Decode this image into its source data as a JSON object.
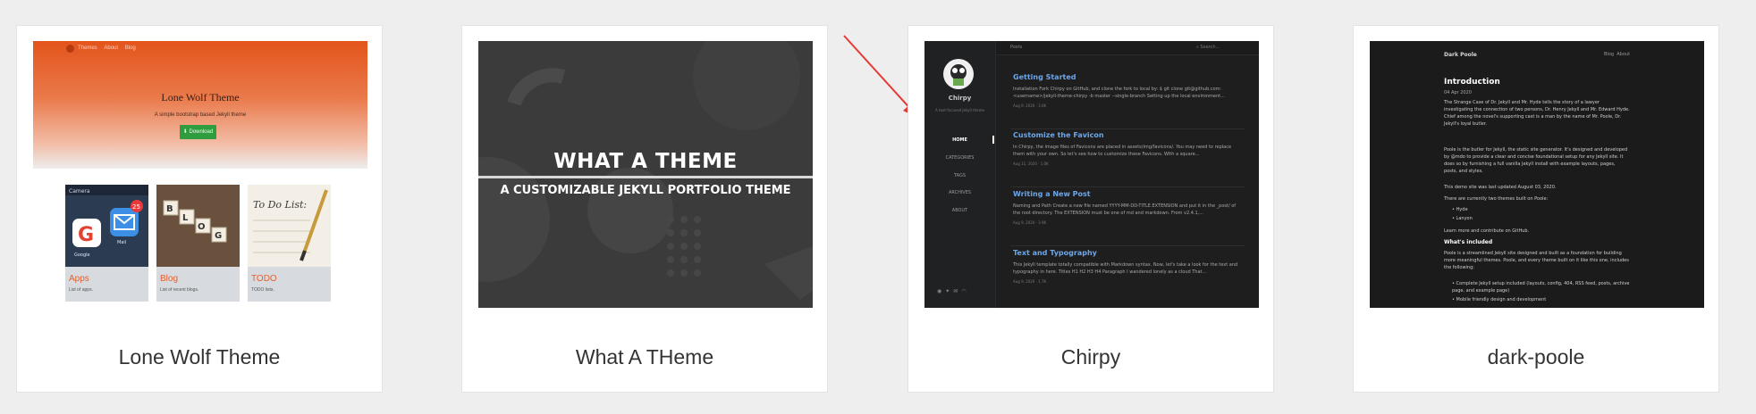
{
  "cards": [
    {
      "title": "Lone Wolf Theme",
      "preview": {
        "nav": [
          "Themes",
          "About",
          "Blog"
        ],
        "heading": "Lone Wolf Theme",
        "subheading": "A simple bootstrap based Jekyll theme",
        "button": "Download",
        "tiles": [
          {
            "caption": "Apps",
            "desc": "List of apps.",
            "badge": "25",
            "icons": [
              "Google",
              "Mail"
            ],
            "top_label": "Camera"
          },
          {
            "caption": "Blog",
            "desc": "List of recent blogs.",
            "blocks": "BLOG"
          },
          {
            "caption": "TODO",
            "desc": "TODO lists.",
            "note": "To Do List:"
          }
        ]
      }
    },
    {
      "title": "What A THeme",
      "preview": {
        "heading": "WHAT A THEME",
        "subheading": "A CUSTOMIZABLE JEKYLL PORTFOLIO THEME"
      }
    },
    {
      "title": "Chirpy",
      "preview": {
        "site_name": "Chirpy",
        "tagline": "A text-focused Jekyll theme",
        "nav": [
          "HOME",
          "CATEGORIES",
          "TAGS",
          "ARCHIVES",
          "ABOUT"
        ],
        "social_icons": [
          "github-icon",
          "twitter-icon",
          "email-icon",
          "rss-icon"
        ],
        "breadcrumb": "Posts",
        "search_placeholder": "Search...",
        "posts": [
          {
            "title": "Getting Started",
            "excerpt": "Installation Fork Chirpy on GitHub, and clone the fork to local by: $ git clone git@github.com: <username>/jekyll-theme-chirpy -b master --single-branch Setting up the local environment...",
            "meta": "Aug 9, 2020  ·  3.0K"
          },
          {
            "title": "Customize the Favicon",
            "excerpt": "In Chirpy, the image files of Favicons are placed in assets/img/favicons/. You may need to replace them with your own. So let's see how to customize these Favicons. With a square...",
            "meta": "Aug 11, 2020  ·  1.0K"
          },
          {
            "title": "Writing a New Post",
            "excerpt": "Naming and Path Create a new file named YYYY-MM-DD-TITLE.EXTENSION and put it in the _post/ of the root directory. The EXTENSION must be one of md and markdown. From v2.4.1,...",
            "meta": "Aug 9, 2020  ·  3.9K"
          },
          {
            "title": "Text and Typography",
            "excerpt": "This Jekyll template totally compatible with Markdown syntax. Now, let's take a look for the text and typography in here. Titles H1 H2 H3 H4 Paragraph I wandered lonely as a cloud That...",
            "meta": "Aug 9, 2020  ·  1.7K"
          }
        ]
      }
    },
    {
      "title": "dark-poole",
      "preview": {
        "brand": "Dark Poole",
        "links": [
          "Blog",
          "About"
        ],
        "heading": "Introduction",
        "date": "04 Apr 2020",
        "para1": "The Strange Case of Dr. Jekyll and Mr. Hyde tells the story of a lawyer investigating the connection of two persons, Dr. Henry Jekyll and Mr. Edward Hyde. Chief among the novel's supporting cast is a man by the name of Mr. Poole, Dr. Jekyll's loyal butler.",
        "para2": "Poole is the butler for Jekyll, the static site generator. It's designed and developed by @mdo to provide a clear and concise foundational setup for any Jekyll site. It does so by furnishing a full vanilla Jekyll install with example layouts, pages, posts, and styles.",
        "para3": "This demo site was last updated August 03, 2020.",
        "para4": "There are currently two themes built on Poole:",
        "list1": [
          "Hyde",
          "Lanyon"
        ],
        "para5": "Learn more and contribute on GitHub.",
        "h2": "What's included",
        "para6": "Poole is a streamlined Jekyll site designed and built as a foundation for building more meaningful themes. Poole, and every theme built on it like this one, includes the following:",
        "list2": [
          "Complete Jekyll setup included (layouts, config, 404, RSS feed, posts, archive page, and example page)",
          "Mobile friendly design and development"
        ]
      }
    }
  ]
}
